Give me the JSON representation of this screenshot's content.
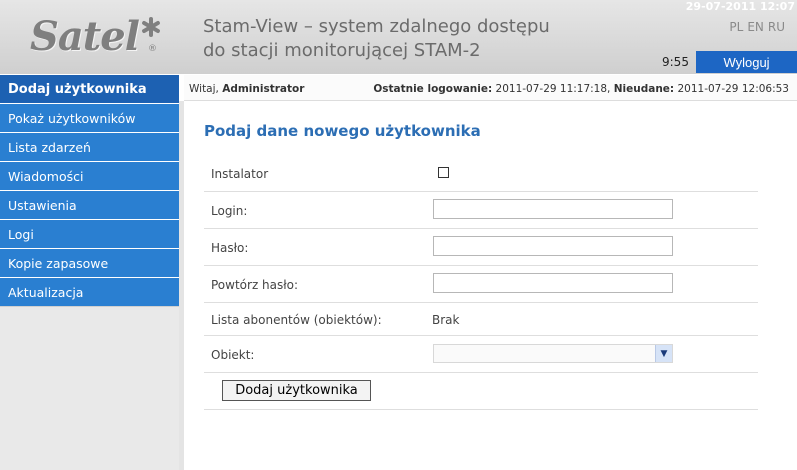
{
  "header": {
    "logo_text": "Satel",
    "logo_reg": "®",
    "title_line1": "Stam-View – system zdalnego dostępu",
    "title_line2": "do stacji monitorującej STAM-2",
    "date": "29-07-2011 12:07",
    "languages": [
      "PL",
      "EN",
      "RU"
    ],
    "clock": "9:55",
    "logout_label": "Wyloguj"
  },
  "sidebar": {
    "items": [
      {
        "label": "Dodaj użytkownika",
        "active": true
      },
      {
        "label": "Pokaż użytkowników"
      },
      {
        "label": "Lista zdarzeń"
      },
      {
        "label": "Wiadomości"
      },
      {
        "label": "Ustawienia"
      },
      {
        "label": "Logi"
      },
      {
        "label": "Kopie zapasowe"
      },
      {
        "label": "Aktualizacja"
      }
    ]
  },
  "status": {
    "greeting": "Witaj,",
    "user": "Administrator",
    "last_login_label": "Ostatnie logowanie:",
    "last_login_value": "2011-07-29 11:17:18,",
    "failed_label": "Nieudane:",
    "failed_value": "2011-07-29 12:06:53"
  },
  "form": {
    "title": "Podaj dane nowego użytkownika",
    "installer_label": "Instalator",
    "login_label": "Login:",
    "login_value": "",
    "password_label": "Hasło:",
    "password_value": "",
    "repeat_label": "Powtórz hasło:",
    "repeat_value": "",
    "subscribers_label": "Lista abonentów (obiektów):",
    "subscribers_value": "Brak",
    "object_label": "Obiekt:",
    "object_value": "",
    "submit_label": "Dodaj użytkownika"
  },
  "colors": {
    "nav_bg": "#2a7fd1",
    "nav_active_bg": "#1d61b2",
    "accent_title": "#2c6eb4",
    "logout_bg": "#1d66c4"
  }
}
